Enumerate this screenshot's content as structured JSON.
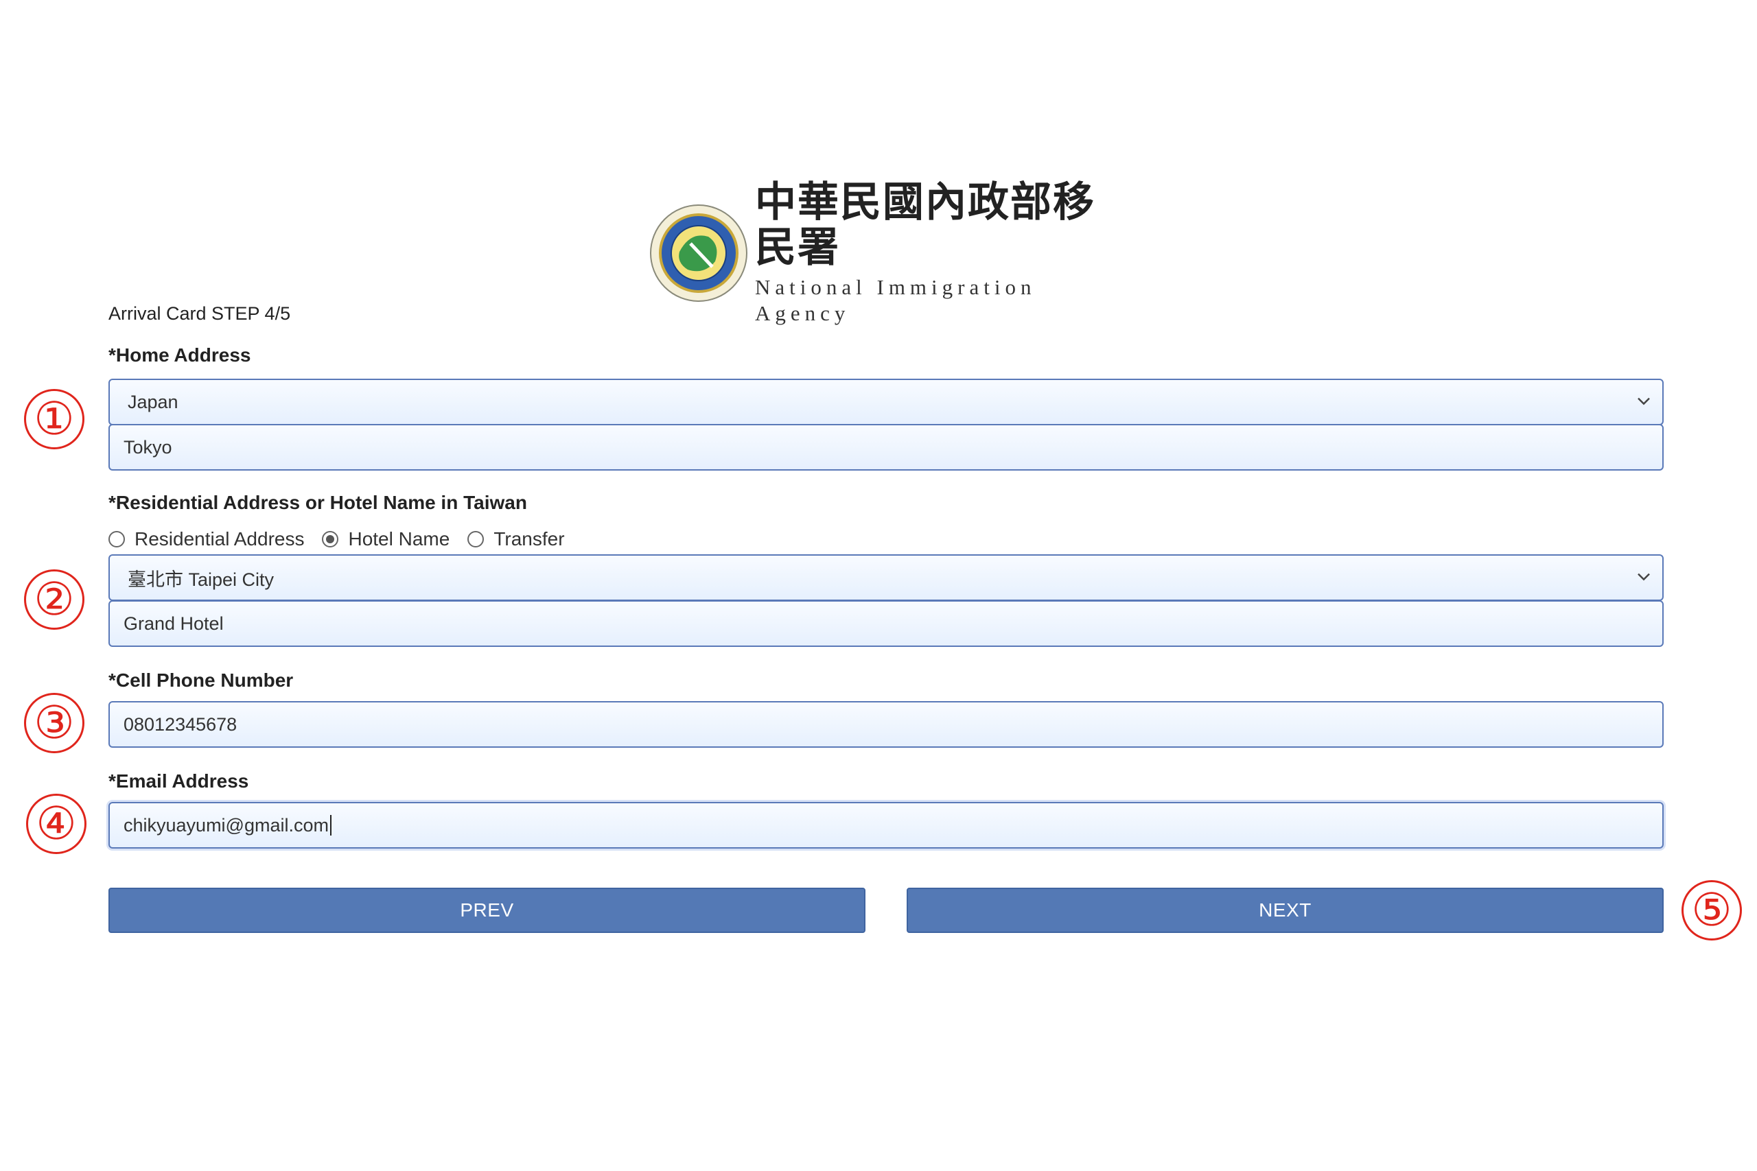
{
  "header": {
    "agency_cn": "中華民國內政部移民署",
    "agency_en": "National Immigration Agency"
  },
  "form": {
    "step": "Arrival Card STEP 4/5",
    "home_address": {
      "label": "*Home Address",
      "country": "Japan",
      "city": "Tokyo"
    },
    "taiwan_address": {
      "label": "*Residential Address or Hotel Name in Taiwan",
      "options": [
        "Residential Address",
        "Hotel Name",
        "Transfer"
      ],
      "selected": "Hotel Name",
      "city": "臺北市 Taipei City",
      "hotel": "Grand Hotel"
    },
    "phone": {
      "label": "*Cell Phone Number",
      "value": "08012345678"
    },
    "email": {
      "label": "*Email Address",
      "value": "chikyuayumi@gmail.com"
    },
    "buttons": {
      "prev": "PREV",
      "next": "NEXT"
    }
  },
  "annotations": [
    "①",
    "②",
    "③",
    "④",
    "⑤"
  ],
  "colors": {
    "button": "#5479b5",
    "field_border": "#5a79b8",
    "marker": "#e0251c"
  }
}
